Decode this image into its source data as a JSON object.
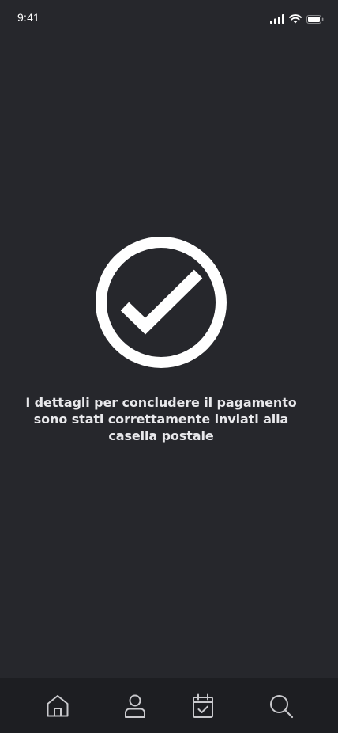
{
  "status_bar": {
    "time": "9:41",
    "icons": [
      "cellular-signal-icon",
      "wifi-icon",
      "battery-icon"
    ]
  },
  "main": {
    "icon": "check-circle-icon",
    "message": "I dettagli per concludere il pagamento sono stati correttamente inviati alla casella postale"
  },
  "tab_bar": {
    "tabs": [
      {
        "icon": "home-icon"
      },
      {
        "icon": "user-icon"
      },
      {
        "icon": "calendar-check-icon"
      },
      {
        "icon": "search-icon"
      }
    ]
  },
  "colors": {
    "background": "#26272c",
    "tab_bar_background": "#1d1e22",
    "foreground": "#ffffff"
  }
}
